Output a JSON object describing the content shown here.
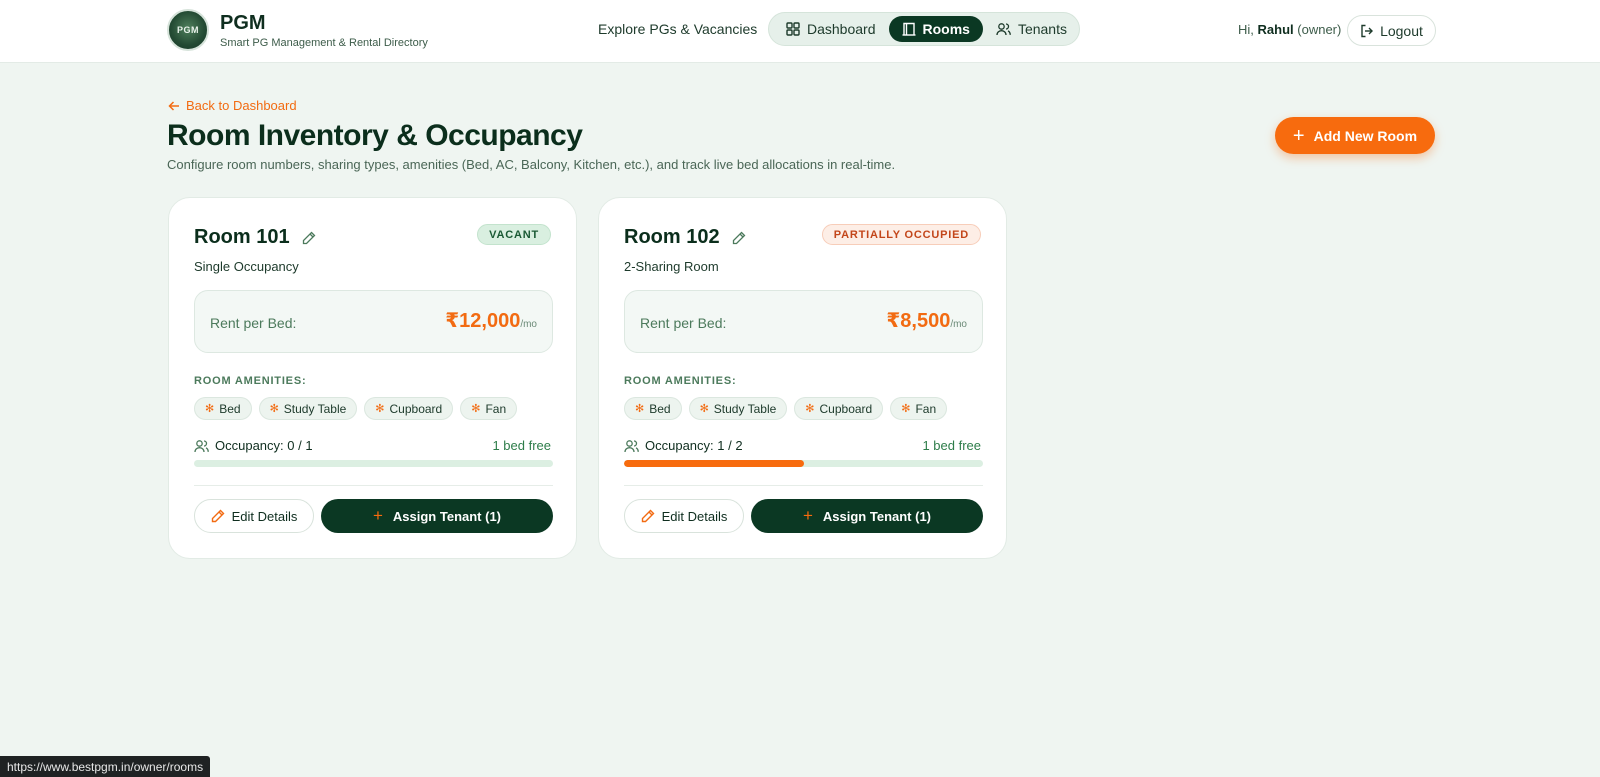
{
  "brand": {
    "name": "PGM",
    "subtitle": "Smart PG Management & Rental Directory",
    "logo_text": "PGM"
  },
  "nav": {
    "explore": "Explore PGs & Vacancies",
    "tabs": [
      {
        "label": "Dashboard",
        "icon": "grid-icon",
        "active": false
      },
      {
        "label": "Rooms",
        "icon": "door-icon",
        "active": true
      },
      {
        "label": "Tenants",
        "icon": "users-icon",
        "active": false
      }
    ]
  },
  "user": {
    "greeting": "Hi,",
    "name": "Rahul",
    "role": "(owner)",
    "logout_label": "Logout"
  },
  "page": {
    "back_label": "Back to Dashboard",
    "title": "Room Inventory & Occupancy",
    "subtitle": "Configure room numbers, sharing types, amenities (Bed, AC, Balcony, Kitchen, etc.), and track live bed allocations in real-time.",
    "add_button": "Add New Room"
  },
  "rooms": [
    {
      "name": "Room 101",
      "status": "VACANT",
      "type": "Single Occupancy",
      "rent_label": "Rent per Bed:",
      "rent": "₹12,000",
      "rent_unit": "/mo",
      "amenities_title": "ROOM AMENITIES:",
      "amenities": [
        "Bed",
        "Study Table",
        "Cupboard",
        "Fan"
      ],
      "occupancy_label": "Occupancy: 0 / 1",
      "occupancy_fraction": 0.0,
      "free_label": "1 bed free",
      "edit_label": "Edit Details",
      "assign_label": "Assign Tenant (1)"
    },
    {
      "name": "Room 102",
      "status": "PARTIALLY OCCUPIED",
      "type": "2-Sharing Room",
      "rent_label": "Rent per Bed:",
      "rent": "₹8,500",
      "rent_unit": "/mo",
      "amenities_title": "ROOM AMENITIES:",
      "amenities": [
        "Bed",
        "Study Table",
        "Cupboard",
        "Fan"
      ],
      "occupancy_label": "Occupancy: 1 / 2",
      "occupancy_fraction": 0.5,
      "free_label": "1 bed free",
      "edit_label": "Edit Details",
      "assign_label": "Assign Tenant (1)"
    }
  ],
  "status_url": "https://www.bestpgm.in/owner/rooms",
  "colors": {
    "accent": "#f76b0e",
    "primary": "#0b3823",
    "background": "#eff5f1"
  }
}
